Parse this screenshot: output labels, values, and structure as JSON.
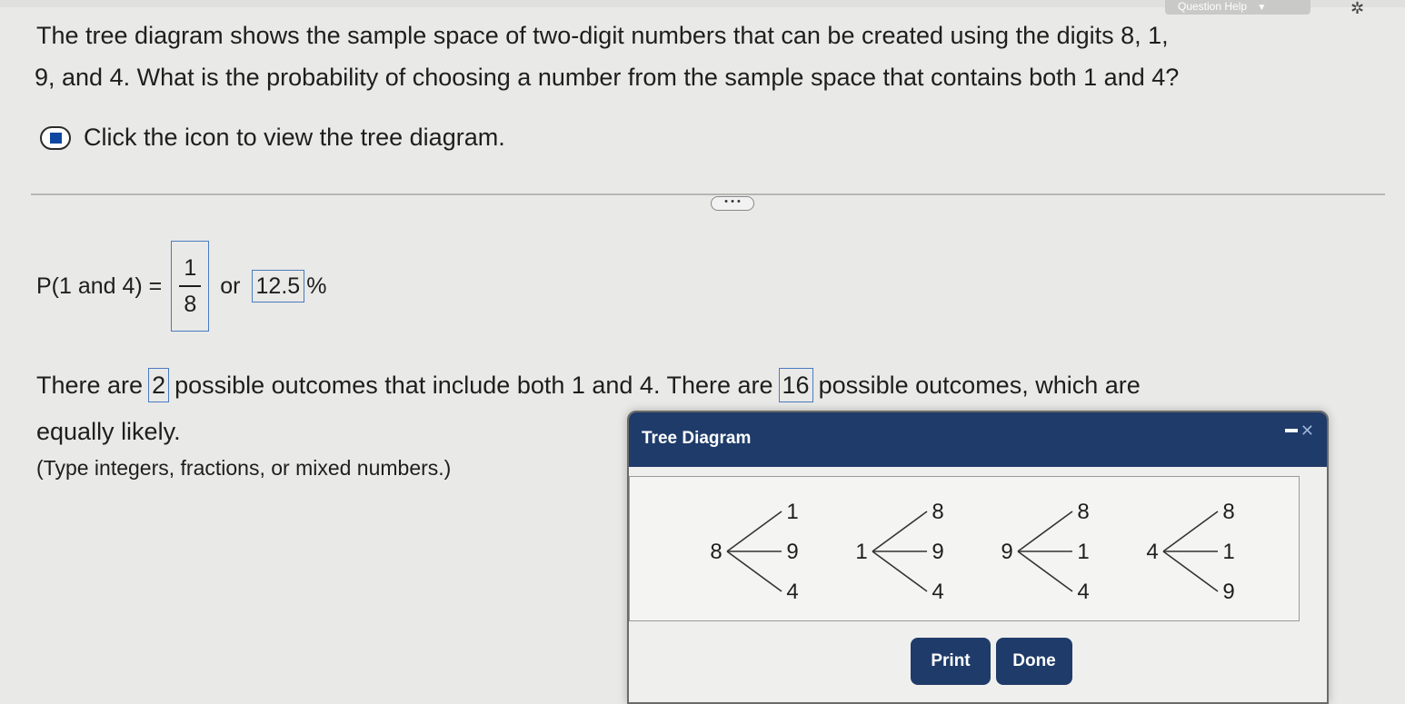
{
  "header": {
    "help_label": "Question Help",
    "help_caret": "▼",
    "settings_glyph": "✲"
  },
  "question": {
    "line1": "The tree diagram shows the sample space of two-digit numbers that can be created using the digits 8, 1,",
    "line2": "9, and 4. What is the probability of choosing a number from the sample space that contains both 1 and 4?",
    "click_text": "Click the icon to view the tree diagram."
  },
  "more_label": "• • •",
  "answer": {
    "prob_label": "P(1 and 4) =",
    "fraction_numerator": "1",
    "fraction_denominator": "8",
    "or_label": "or",
    "percent_value": "12.5",
    "percent_sign": "%",
    "outcome_part1": "There are",
    "outcome_value1": "2",
    "outcome_part2": "possible outcomes that include both 1 and 4. There are",
    "outcome_value2": "16",
    "outcome_part3": "possible outcomes, which are",
    "likely_text": "equally likely.",
    "type_hint": "(Type integers, fractions, or mixed numbers.)"
  },
  "tree_window": {
    "title": "Tree Diagram",
    "close_glyph": "✕",
    "roots": [
      {
        "label": "8",
        "branches": [
          "1",
          "9",
          "4"
        ]
      },
      {
        "label": "1",
        "branches": [
          "8",
          "9",
          "4"
        ]
      },
      {
        "label": "9",
        "branches": [
          "8",
          "1",
          "4"
        ]
      },
      {
        "label": "4",
        "branches": [
          "8",
          "1",
          "9"
        ]
      }
    ],
    "print_label": "Print",
    "done_label": "Done"
  }
}
